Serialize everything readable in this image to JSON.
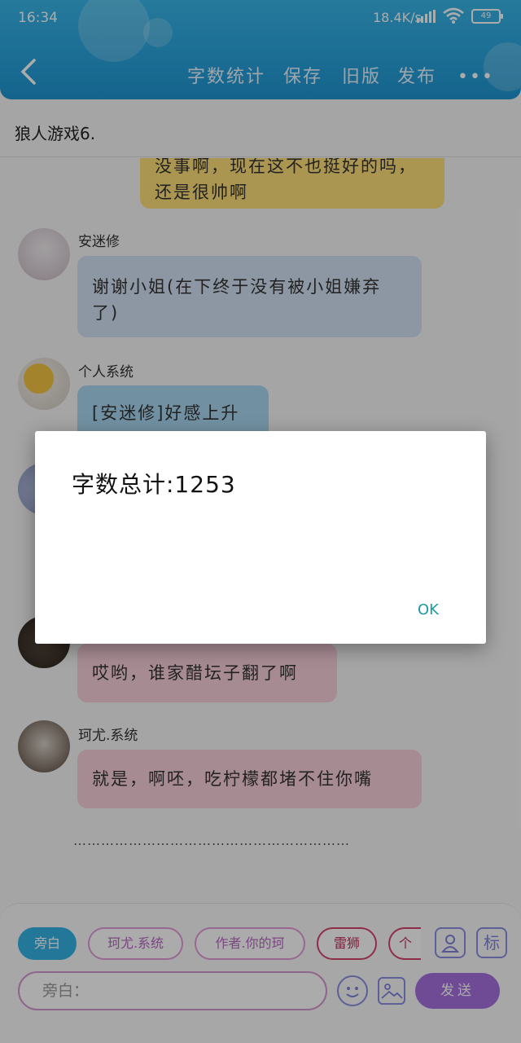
{
  "status_bar": {
    "time": "16:34",
    "speed": "18.4K/s",
    "battery": "49"
  },
  "nav": {
    "actions": [
      "字数统计",
      "保存",
      "旧版",
      "发布"
    ],
    "more": "•••"
  },
  "document": {
    "title": "狼人游戏6."
  },
  "messages": [
    {
      "speaker": "",
      "text": "没事啊，现在这不也挺好的吗，还是很帅啊",
      "color": "#ffe07a"
    },
    {
      "speaker": "安迷修",
      "text": "谢谢小姐(在下终于没有被小姐嫌弃了)",
      "color": "#d2e2f3"
    },
    {
      "speaker": "个人系统",
      "text": "[安迷修]好感上升",
      "color": "#a9d9f3"
    },
    {
      "speaker": "",
      "text": "",
      "color": ""
    },
    {
      "speaker": "",
      "text": "哎哟，谁家醋坛子翻了啊",
      "color": "#f9d0dc"
    },
    {
      "speaker": "珂尤.系统",
      "text": "就是，啊呸，吃柠檬都堵不住你嘴",
      "color": "#f9d0dc"
    }
  ],
  "ellipsis": "……………………………………………………",
  "roles": [
    "旁白",
    "珂尤.系统",
    "作者.你的珂",
    "雷狮",
    "个"
  ],
  "icons": {
    "person": "person-icon",
    "mark": "标"
  },
  "input": {
    "placeholder": "旁白："
  },
  "send_label": "发送",
  "dialog": {
    "message": "字数总计:1253",
    "ok_label": "OK"
  },
  "colors": {
    "header": "#2aa6de",
    "accent_purple": "#a670de",
    "ok": "#1a9ba0"
  }
}
